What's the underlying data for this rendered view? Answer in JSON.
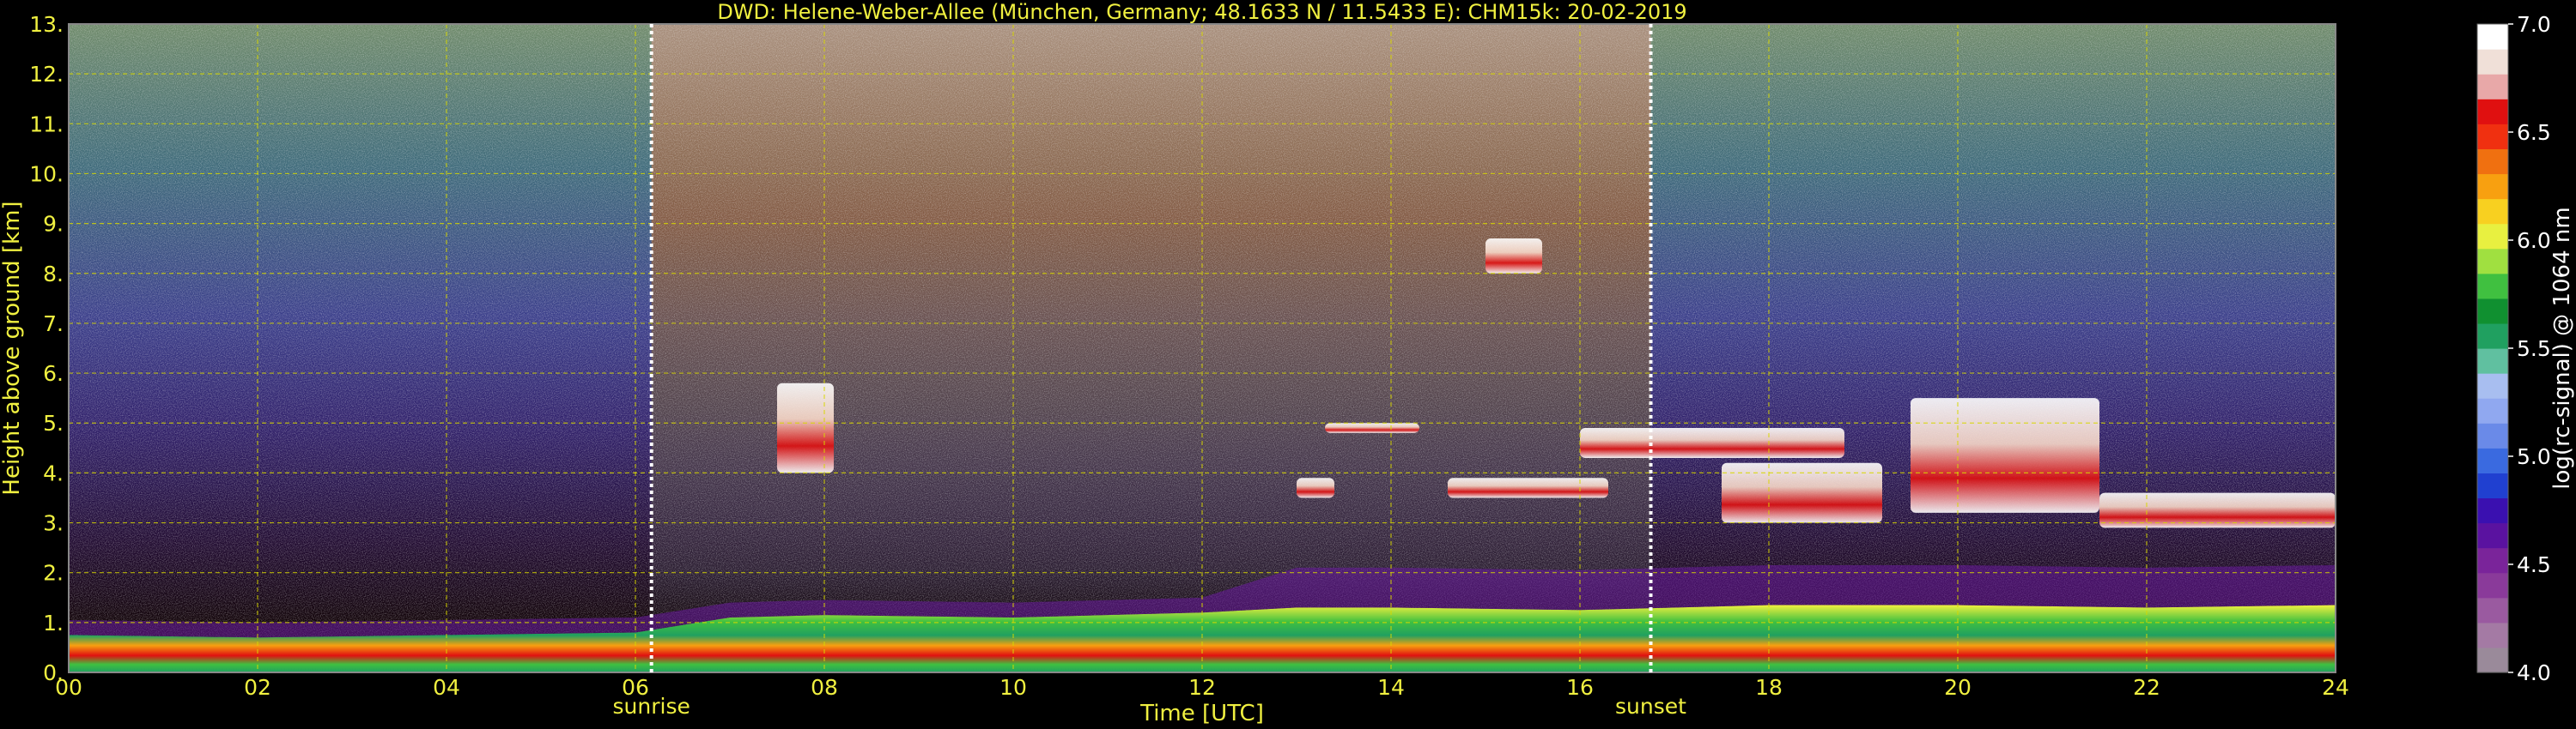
{
  "chart_data": {
    "type": "heatmap",
    "title": "DWD: Helene-Weber-Allee (München, Germany; 48.1633 N / 11.5433 E):    CHM15k: 20-02-2019",
    "xlabel": "Time [UTC]",
    "ylabel": "Height above ground [km]",
    "xlim": [
      0,
      24
    ],
    "ylim": [
      0,
      13
    ],
    "x_ticks": [
      "00",
      "02",
      "04",
      "06",
      "08",
      "10",
      "12",
      "14",
      "16",
      "18",
      "20",
      "22",
      "24"
    ],
    "y_ticks": [
      "0.",
      "1.",
      "2.",
      "3.",
      "4.",
      "5.",
      "6.",
      "7.",
      "8.",
      "9.",
      "10.",
      "11.",
      "12.",
      "13."
    ],
    "grid": true,
    "colorbar": {
      "label": "log(rc-signal) @ 1064 nm",
      "range": [
        4.0,
        7.0
      ],
      "ticks": [
        "4.0",
        "4.5",
        "5.0",
        "5.5",
        "6.0",
        "6.5",
        "7.0"
      ],
      "colors": [
        "#9a8a9a",
        "#a47aa4",
        "#9a5aa0",
        "#8a3a9a",
        "#7a249a",
        "#5a12a0",
        "#3a10b0",
        "#2040d0",
        "#3a6ae0",
        "#6a8ae8",
        "#90a8f0",
        "#a8bef0",
        "#60c0a0",
        "#20a060",
        "#109030",
        "#40c040",
        "#a0e040",
        "#e8f040",
        "#f8d020",
        "#f8a010",
        "#f07010",
        "#f03010",
        "#e01010",
        "#e8a8a8",
        "#f0e0d8",
        "#ffffff"
      ]
    },
    "annotations": [
      {
        "text": "sunrise",
        "x": 6.17
      },
      {
        "text": "sunset",
        "x": 16.75
      }
    ],
    "features": {
      "boundary_layer_top_km": [
        [
          0,
          0.75
        ],
        [
          2,
          0.7
        ],
        [
          4,
          0.75
        ],
        [
          6,
          0.8
        ],
        [
          7,
          1.1
        ],
        [
          8,
          1.15
        ],
        [
          10,
          1.1
        ],
        [
          12,
          1.2
        ],
        [
          13,
          1.3
        ],
        [
          14,
          1.3
        ],
        [
          16,
          1.25
        ],
        [
          18,
          1.35
        ],
        [
          20,
          1.35
        ],
        [
          22,
          1.3
        ],
        [
          24,
          1.35
        ]
      ],
      "cloud_layers": [
        {
          "t_start": 7.5,
          "t_end": 8.1,
          "base_km": 4.0,
          "top_km": 5.8
        },
        {
          "t_start": 13.0,
          "t_end": 13.4,
          "base_km": 3.5,
          "top_km": 3.9
        },
        {
          "t_start": 13.3,
          "t_end": 14.3,
          "base_km": 4.8,
          "top_km": 5.0
        },
        {
          "t_start": 14.6,
          "t_end": 16.3,
          "base_km": 3.5,
          "top_km": 3.9
        },
        {
          "t_start": 15.0,
          "t_end": 15.6,
          "base_km": 8.0,
          "top_km": 8.7
        },
        {
          "t_start": 16.0,
          "t_end": 18.8,
          "base_km": 4.3,
          "top_km": 4.9
        },
        {
          "t_start": 17.5,
          "t_end": 19.2,
          "base_km": 3.0,
          "top_km": 4.2
        },
        {
          "t_start": 19.5,
          "t_end": 21.5,
          "base_km": 3.2,
          "top_km": 5.5
        },
        {
          "t_start": 21.5,
          "t_end": 24.0,
          "base_km": 2.9,
          "top_km": 3.6
        }
      ]
    }
  }
}
